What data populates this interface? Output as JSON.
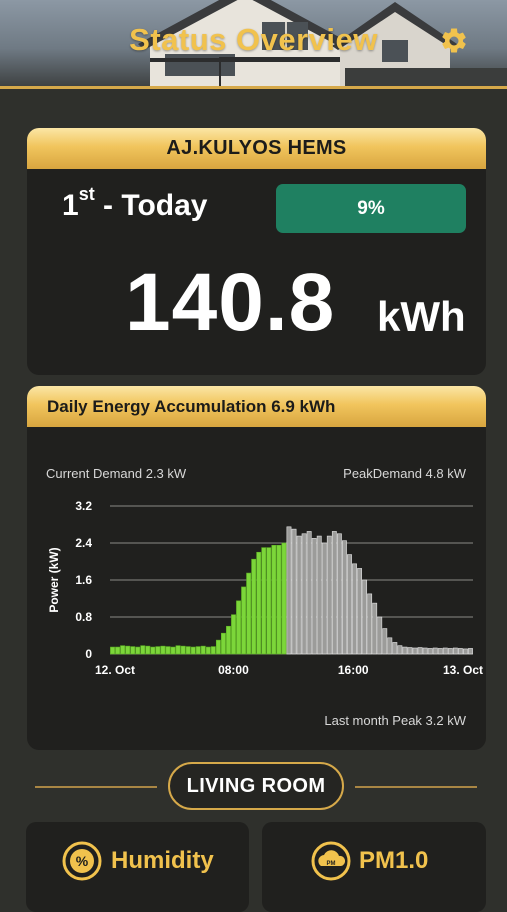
{
  "header": {
    "title": "Status Overview",
    "settings_icon": "gear-icon",
    "accent": "#f1c24d"
  },
  "summary": {
    "system_name": "AJ.KULYOS HEMS",
    "day_number": "1",
    "day_suffix": "st",
    "day_label": "- Today",
    "percent": "9%",
    "energy_value": "140.8",
    "energy_unit": "kWh",
    "percent_color": "#1f8061"
  },
  "accumulation": {
    "title": "Daily Energy Accumulation 6.9 kWh",
    "current_demand": "Current  Demand 2.3  kW",
    "peak_demand": "PeakDemand 4.8  kW",
    "last_month_peak": "Last month Peak 3.2 kW"
  },
  "chart_data": {
    "type": "bar",
    "ylabel": "Power (kW)",
    "ylim": [
      0,
      3.2
    ],
    "yticks": [
      "3.2",
      "2.4",
      "1.6",
      "0.8",
      "0"
    ],
    "x_ticks": [
      "12. Oct",
      "08:00",
      "16:00",
      "13. Oct"
    ],
    "grid": true,
    "series": [
      {
        "values": [
          0.15,
          0.15,
          0.18,
          0.17,
          0.16,
          0.15,
          0.18,
          0.17,
          0.15,
          0.16,
          0.17,
          0.16,
          0.15,
          0.18,
          0.17,
          0.16,
          0.15,
          0.16,
          0.17,
          0.15,
          0.16,
          0.3,
          0.45,
          0.6,
          0.85,
          1.15,
          1.45,
          1.75,
          2.05,
          2.2,
          2.3,
          2.3,
          2.35,
          2.35,
          2.4
        ]
      },
      {
        "values": [
          2.75,
          2.7,
          2.55,
          2.6,
          2.65,
          2.5,
          2.55,
          2.4,
          2.55,
          2.65,
          2.6,
          2.45,
          2.15,
          1.95,
          1.85,
          1.6,
          1.3,
          1.1,
          0.8,
          0.55,
          0.35,
          0.25,
          0.18,
          0.15,
          0.14,
          0.13,
          0.14,
          0.13,
          0.12,
          0.13,
          0.12,
          0.13,
          0.12,
          0.13,
          0.12,
          0.11,
          0.12
        ]
      }
    ],
    "colors": [
      "#7cd63a",
      "#bdbdbd"
    ]
  },
  "room": {
    "label": "LIVING ROOM"
  },
  "tiles": [
    {
      "label": "Humidity",
      "icon": "percent-icon"
    },
    {
      "label": "PM1.0",
      "icon": "pm-cloud-icon"
    }
  ]
}
